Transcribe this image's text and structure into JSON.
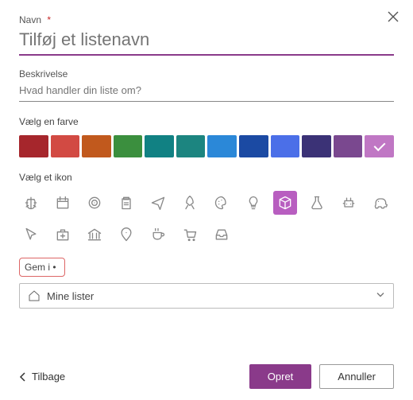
{
  "close_icon": "close",
  "name_field": {
    "label": "Navn",
    "required": "*",
    "placeholder": "Tilføj et listenavn",
    "value": ""
  },
  "desc_field": {
    "label": "Beskrivelse",
    "placeholder": "Hvad handler din liste om?",
    "value": ""
  },
  "color_section": {
    "label": "Vælg en farve",
    "colors": [
      "#a6262c",
      "#d24a43",
      "#c1591d",
      "#3b8f3e",
      "#118183",
      "#1c8580",
      "#2b88d8",
      "#1b4aa3",
      "#4b6fe8",
      "#3b3276",
      "#7a488f",
      "#c077c4"
    ],
    "selected_index": 11
  },
  "icon_section": {
    "label": "Vælg et ikon",
    "icons": [
      "bug",
      "calendar",
      "target",
      "clipboard",
      "airplane",
      "rocket",
      "palette",
      "lightbulb",
      "cube",
      "flask",
      "robot",
      "piggy-bank",
      "cursor",
      "first-aid",
      "bank",
      "map-pin",
      "coffee",
      "cart",
      "inbox"
    ],
    "selected_index": 8
  },
  "save_in": {
    "label": "Gem i",
    "bullet": "•",
    "selected": "Mine lister"
  },
  "footer": {
    "back": "Tilbage",
    "create": "Opret",
    "cancel": "Annuller"
  }
}
